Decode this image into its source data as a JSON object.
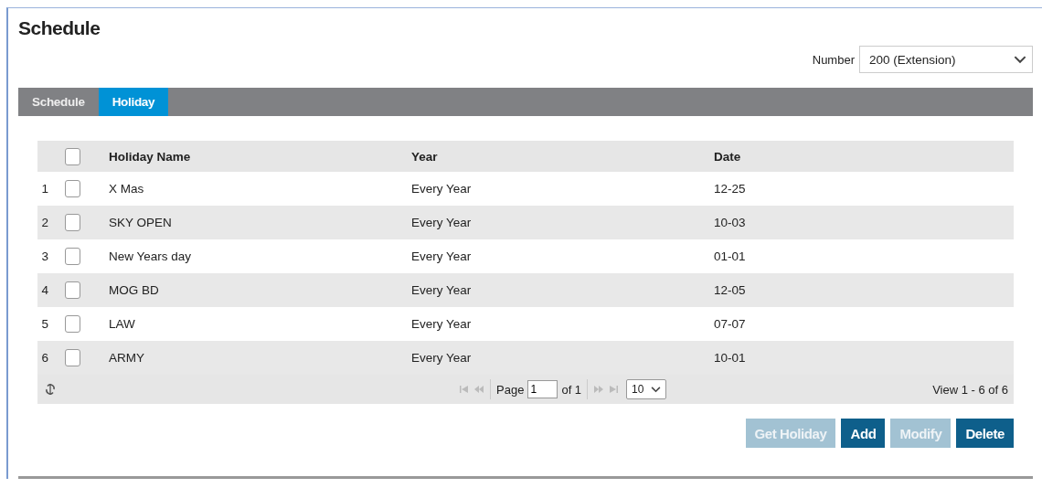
{
  "title": "Schedule",
  "number_select": {
    "label": "Number",
    "value": "200 (Extension)"
  },
  "tabs": [
    {
      "label": "Schedule",
      "selected": false
    },
    {
      "label": "Holiday",
      "selected": true
    }
  ],
  "table": {
    "select_all": {
      "checked": false
    },
    "columns": [
      "Holiday Name",
      "Year",
      "Date"
    ],
    "rows": [
      {
        "index": "1",
        "checked": false,
        "cells": [
          "X Mas",
          "Every Year",
          "12-25"
        ]
      },
      {
        "index": "2",
        "checked": false,
        "cells": [
          "SKY OPEN",
          "Every Year",
          "10-03"
        ]
      },
      {
        "index": "3",
        "checked": false,
        "cells": [
          "New Years day",
          "Every Year",
          "01-01"
        ]
      },
      {
        "index": "4",
        "checked": false,
        "cells": [
          "MOG BD",
          "Every Year",
          "12-05"
        ]
      },
      {
        "index": "5",
        "checked": false,
        "cells": [
          "LAW",
          "Every Year",
          "07-07"
        ]
      },
      {
        "index": "6",
        "checked": false,
        "cells": [
          "ARMY",
          "Every Year",
          "10-01"
        ]
      }
    ]
  },
  "pager": {
    "page_label": "Page",
    "page": "1",
    "of_label": "of 1",
    "page_size": "10",
    "view": "View 1 - 6 of 6"
  },
  "buttons": [
    {
      "label": "Get Holiday",
      "disabled": true
    },
    {
      "label": "Add",
      "disabled": false
    },
    {
      "label": "Modify",
      "disabled": true
    },
    {
      "label": "Delete",
      "disabled": false
    }
  ]
}
